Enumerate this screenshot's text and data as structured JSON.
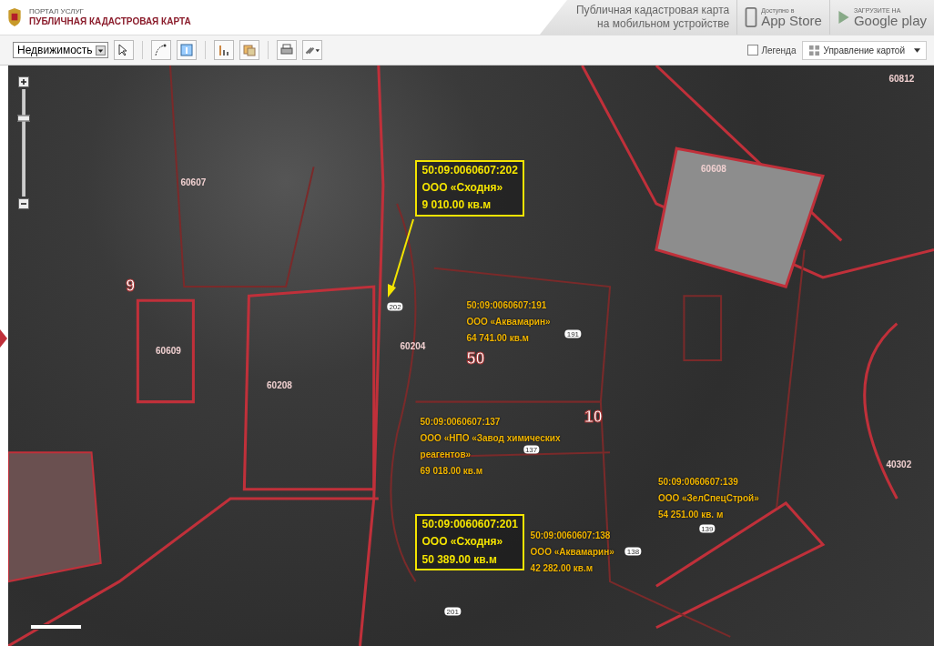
{
  "header": {
    "portal": "ПОРТАЛ УСЛУГ",
    "title": "ПУБЛИЧНАЯ КАДАСТРОВАЯ КАРТА",
    "mobile_text": [
      "Публичная кадастровая карта",
      "на мобильном устройстве"
    ],
    "stores": [
      {
        "kind": "apple",
        "small": "Доступно в",
        "big": "App Store"
      },
      {
        "kind": "google",
        "small": "ЗАГРУЗИТЕ НА",
        "big": "Google play"
      }
    ]
  },
  "toolbar": {
    "layer_select": "Недвижимость",
    "tools": [
      {
        "kind": "pointer"
      },
      {
        "kind": "measure"
      },
      {
        "kind": "info"
      },
      {
        "kind": "chart"
      },
      {
        "kind": "layers"
      },
      {
        "kind": "print"
      },
      {
        "kind": "link"
      }
    ],
    "legend": {
      "label": "Легенда",
      "checked": false
    },
    "map_control": "Управление картой"
  },
  "map": {
    "zoom": {
      "level": 0.73
    },
    "areas": [
      {
        "text": "50",
        "kind": "district"
      },
      {
        "text": "10",
        "kind": "district"
      },
      {
        "text": "9",
        "kind": "district"
      },
      {
        "text": "60607",
        "kind": "quarter"
      },
      {
        "text": "60609",
        "kind": "quarter"
      },
      {
        "text": "60208",
        "kind": "quarter"
      },
      {
        "text": "60204",
        "kind": "quarter"
      },
      {
        "text": "60608",
        "kind": "quarter"
      },
      {
        "text": "60812",
        "kind": "quarter"
      },
      {
        "text": "40302",
        "kind": "quarter"
      }
    ],
    "parcels": [
      "202",
      "191",
      "137",
      "201",
      "138",
      "139"
    ],
    "callouts": [
      {
        "kind": "boxed",
        "lines": [
          "50:09:0060607:202",
          "ООО «Сходня»",
          "9 010.00 кв.м"
        ]
      },
      {
        "kind": "boxed",
        "lines": [
          "50:09:0060607:201",
          "ООО «Сходня»",
          "50 389.00 кв.м"
        ]
      },
      {
        "kind": "plain",
        "lines": [
          "50:09:0060607:191",
          "ООО «Аквамарин»",
          "64 741.00 кв.м"
        ]
      },
      {
        "kind": "plain",
        "lines": [
          "50:09:0060607:137",
          "ООО «НПО «Завод химических",
          "реагентов»",
          "69 018.00 кв.м"
        ]
      },
      {
        "kind": "plain",
        "lines": [
          "50:09:0060607:138",
          "ООО «Аквамарин»",
          "42 282.00 кв.м"
        ]
      },
      {
        "kind": "plain",
        "lines": [
          "50:09:0060607:139",
          "ООО «ЗелСпецСтрой»",
          "54 251.00 кв. м"
        ]
      }
    ]
  }
}
